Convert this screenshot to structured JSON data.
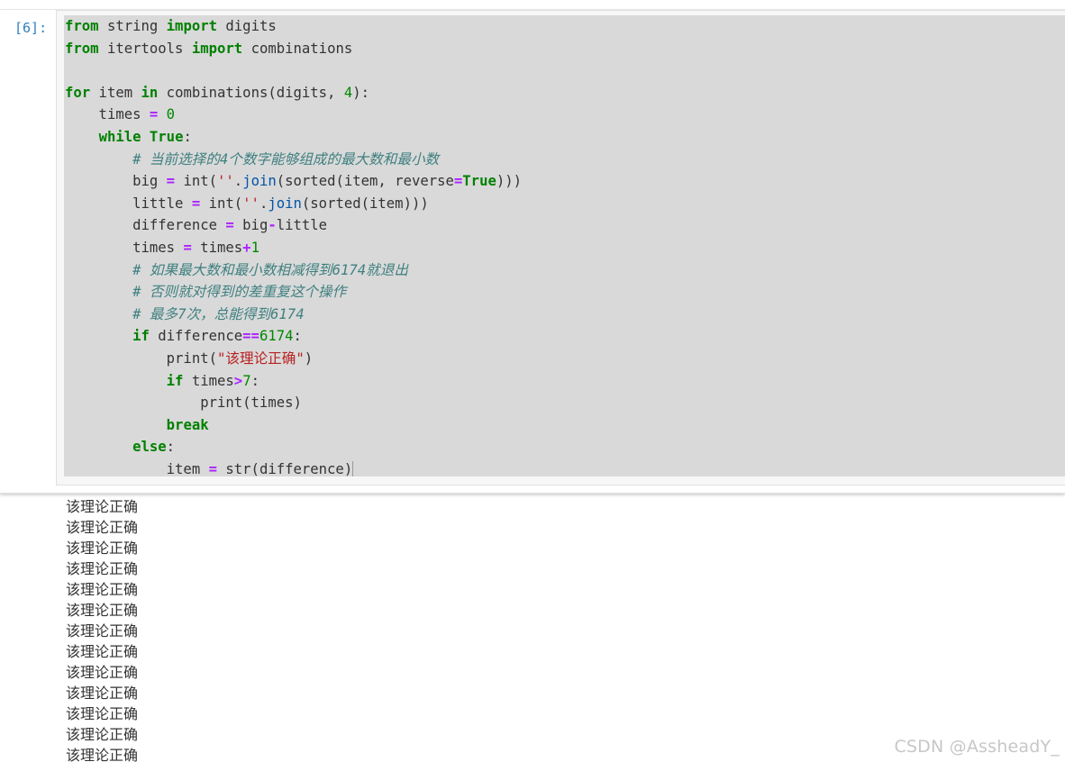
{
  "cell": {
    "prompt": "[6]:",
    "code_lines": [
      [
        [
          "kw",
          "from"
        ],
        [
          "t",
          " string "
        ],
        [
          "kw",
          "import"
        ],
        [
          "t",
          " digits"
        ]
      ],
      [
        [
          "kw",
          "from"
        ],
        [
          "t",
          " itertools "
        ],
        [
          "kw",
          "import"
        ],
        [
          "t",
          " combinations"
        ]
      ],
      [],
      [
        [
          "kw",
          "for"
        ],
        [
          "t",
          " item "
        ],
        [
          "kw",
          "in"
        ],
        [
          "t",
          " combinations(digits, "
        ],
        [
          "num",
          "4"
        ],
        [
          "t",
          "):"
        ]
      ],
      [
        [
          "t",
          "    times "
        ],
        [
          "op",
          "="
        ],
        [
          "t",
          " "
        ],
        [
          "num",
          "0"
        ]
      ],
      [
        [
          "t",
          "    "
        ],
        [
          "kw",
          "while"
        ],
        [
          "t",
          " "
        ],
        [
          "kw",
          "True"
        ],
        [
          "t",
          ":"
        ]
      ],
      [
        [
          "t",
          "        "
        ],
        [
          "comment",
          "# 当前选择的4个数字能够组成的最大数和最小数"
        ]
      ],
      [
        [
          "t",
          "        big "
        ],
        [
          "op",
          "="
        ],
        [
          "t",
          " int("
        ],
        [
          "str",
          "''"
        ],
        [
          "t",
          "."
        ],
        [
          "attr",
          "join"
        ],
        [
          "t",
          "(sorted(item, reverse"
        ],
        [
          "op",
          "="
        ],
        [
          "kw",
          "True"
        ],
        [
          "t",
          ")))"
        ]
      ],
      [
        [
          "t",
          "        little "
        ],
        [
          "op",
          "="
        ],
        [
          "t",
          " int("
        ],
        [
          "str",
          "''"
        ],
        [
          "t",
          "."
        ],
        [
          "attr",
          "join"
        ],
        [
          "t",
          "(sorted(item)))"
        ]
      ],
      [
        [
          "t",
          "        difference "
        ],
        [
          "op",
          "="
        ],
        [
          "t",
          " big"
        ],
        [
          "op",
          "-"
        ],
        [
          "t",
          "little"
        ]
      ],
      [
        [
          "t",
          "        times "
        ],
        [
          "op",
          "="
        ],
        [
          "t",
          " times"
        ],
        [
          "op",
          "+"
        ],
        [
          "num",
          "1"
        ]
      ],
      [
        [
          "t",
          "        "
        ],
        [
          "comment",
          "# 如果最大数和最小数相减得到6174就退出"
        ]
      ],
      [
        [
          "t",
          "        "
        ],
        [
          "comment",
          "# 否则就对得到的差重复这个操作"
        ]
      ],
      [
        [
          "t",
          "        "
        ],
        [
          "comment",
          "# 最多7次，总能得到6174"
        ]
      ],
      [
        [
          "t",
          "        "
        ],
        [
          "kw",
          "if"
        ],
        [
          "t",
          " difference"
        ],
        [
          "op",
          "=="
        ],
        [
          "num",
          "6174"
        ],
        [
          "t",
          ":"
        ]
      ],
      [
        [
          "t",
          "            print("
        ],
        [
          "str",
          "\"该理论正确\""
        ],
        [
          "t",
          ")"
        ]
      ],
      [
        [
          "t",
          "            "
        ],
        [
          "kw",
          "if"
        ],
        [
          "t",
          " times"
        ],
        [
          "op",
          ">"
        ],
        [
          "num",
          "7"
        ],
        [
          "t",
          ":"
        ]
      ],
      [
        [
          "t",
          "                print(times)"
        ]
      ],
      [
        [
          "t",
          "            "
        ],
        [
          "kw",
          "break"
        ]
      ],
      [
        [
          "t",
          "        "
        ],
        [
          "kw",
          "else"
        ],
        [
          "t",
          ":"
        ]
      ],
      [
        [
          "t",
          "            item "
        ],
        [
          "op",
          "="
        ],
        [
          "t",
          " str(difference)"
        ]
      ]
    ]
  },
  "output": {
    "lines": [
      "该理论正确",
      "该理论正确",
      "该理论正确",
      "该理论正确",
      "该理论正确",
      "该理论正确",
      "该理论正确",
      "该理论正确",
      "该理论正确",
      "该理论正确",
      "该理论正确",
      "该理论正确",
      "该理论正确"
    ]
  },
  "watermark": "CSDN @AssheadY_",
  "colors": {
    "prompt": "#307fc1",
    "keyword": "#008000",
    "operator": "#aa22ff",
    "number": "#008800",
    "string": "#ba2121",
    "comment": "#408080",
    "code_background": "#d9d9d9"
  }
}
